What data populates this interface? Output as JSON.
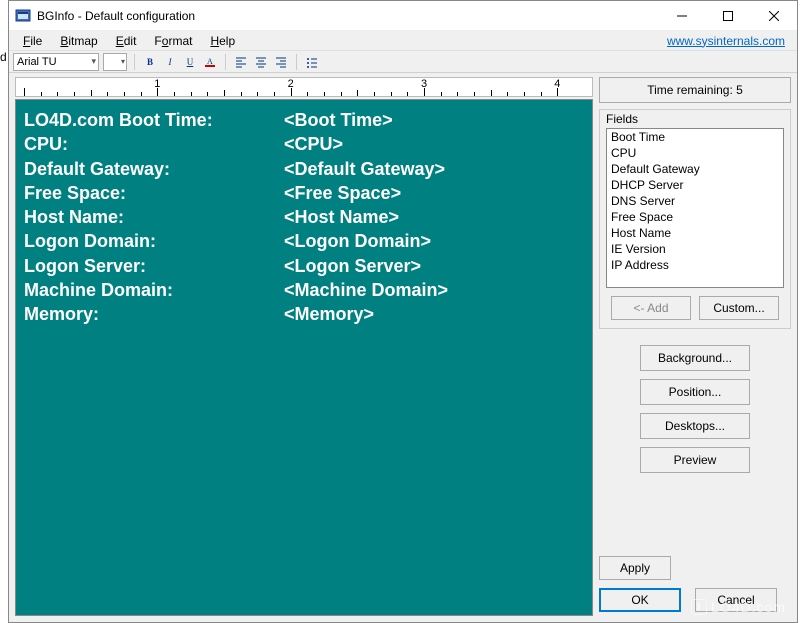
{
  "window": {
    "title": "BGInfo - Default configuration"
  },
  "menu": {
    "file": "File",
    "bitmap": "Bitmap",
    "edit": "Edit",
    "format": "Format",
    "help": "Help",
    "link": "www.sysinternals.com"
  },
  "toolbar": {
    "font_name": "Arial TU",
    "font_size": ""
  },
  "time_remaining": "Time remaining: 5",
  "editor_rows": [
    {
      "label": "LO4D.com Boot Time:",
      "value": "<Boot Time>"
    },
    {
      "label": "CPU:",
      "value": "<CPU>"
    },
    {
      "label": "Default Gateway:",
      "value": "<Default Gateway>"
    },
    {
      "label": "Free Space:",
      "value": "<Free Space>"
    },
    {
      "label": "Host Name:",
      "value": "<Host Name>"
    },
    {
      "label": "Logon Domain:",
      "value": "<Logon Domain>"
    },
    {
      "label": "Logon Server:",
      "value": "<Logon Server>"
    },
    {
      "label": "Machine Domain:",
      "value": "<Machine Domain>"
    },
    {
      "label": "Memory:",
      "value": "<Memory>"
    }
  ],
  "fields": {
    "label": "Fields",
    "items": [
      "Boot Time",
      "CPU",
      "Default Gateway",
      "DHCP Server",
      "DNS Server",
      "Free Space",
      "Host Name",
      "IE Version",
      "IP Address"
    ],
    "add_label": "<- Add",
    "custom_label": "Custom..."
  },
  "buttons": {
    "background": "Background...",
    "position": "Position...",
    "desktops": "Desktops...",
    "preview": "Preview",
    "apply": "Apply",
    "ok": "OK",
    "cancel": "Cancel"
  },
  "ruler_labels": [
    "1",
    "2",
    "3",
    "4"
  ],
  "edge_letter": "d",
  "watermark": "LO4D.com"
}
